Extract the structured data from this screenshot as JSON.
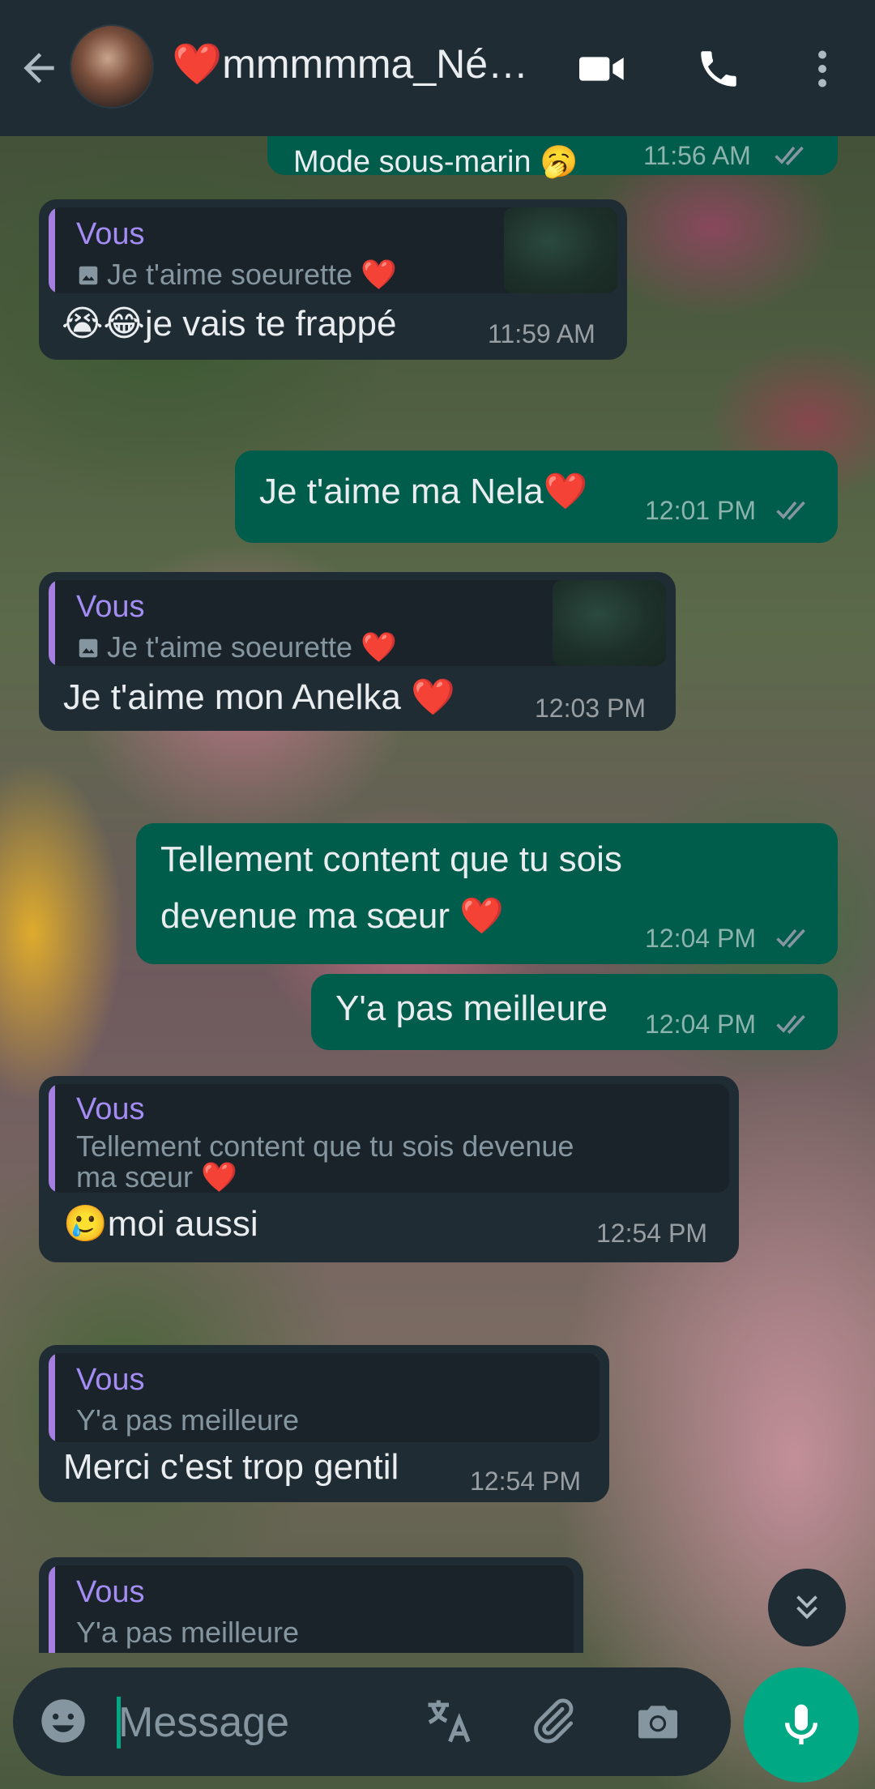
{
  "header": {
    "contact_name": "❤️mmmmma_Né…",
    "icons": [
      "back-arrow-icon",
      "video-camera-icon",
      "phone-icon",
      "more-vert-icon"
    ]
  },
  "messages": [
    {
      "direction": "out",
      "text": "Mode sous-marin 🥱",
      "time": "11:56 AM",
      "status": "read"
    },
    {
      "direction": "in",
      "quote": {
        "author": "Vous",
        "text": "Je t'aime soeurette ❤️",
        "has_photo": true
      },
      "text": "😭😂je vais te frappé",
      "time": "11:59 AM"
    },
    {
      "direction": "out",
      "text": "Je t'aime ma Nela❤️",
      "time": "12:01 PM",
      "status": "read"
    },
    {
      "direction": "in",
      "quote": {
        "author": "Vous",
        "text": "Je t'aime soeurette ❤️",
        "has_photo": true
      },
      "text": "Je t'aime mon Anelka ❤️",
      "time": "12:03 PM"
    },
    {
      "direction": "out",
      "text_line1": "Tellement content que tu sois",
      "text_line2": "devenue ma sœur ❤️",
      "time": "12:04 PM",
      "status": "read"
    },
    {
      "direction": "out",
      "text": "Y'a pas meilleure",
      "time": "12:04 PM",
      "status": "read"
    },
    {
      "direction": "in",
      "quote": {
        "author": "Vous",
        "text_line1": "Tellement content que tu sois devenue",
        "text_line2": "ma sœur ❤️"
      },
      "text": "🥲moi aussi",
      "time": "12:54 PM"
    },
    {
      "direction": "in",
      "quote": {
        "author": "Vous",
        "text": "Y'a pas meilleure"
      },
      "text": "Merci c'est trop gentil",
      "time": "12:54 PM"
    },
    {
      "direction": "in",
      "quote": {
        "author": "Vous",
        "text": "Y'a pas meilleure"
      }
    }
  ],
  "composer": {
    "placeholder": "Message",
    "icons": [
      "emoji-icon",
      "translate-icon",
      "attach-icon",
      "camera-icon",
      "mic-icon"
    ]
  },
  "colors": {
    "header_bg": "#1f2c34",
    "incoming_bubble": "#202c33",
    "outgoing_bubble": "#005c4b",
    "accent": "#00a884",
    "quote_author": "#a48cf5",
    "read_ticks": "#8696a0"
  }
}
